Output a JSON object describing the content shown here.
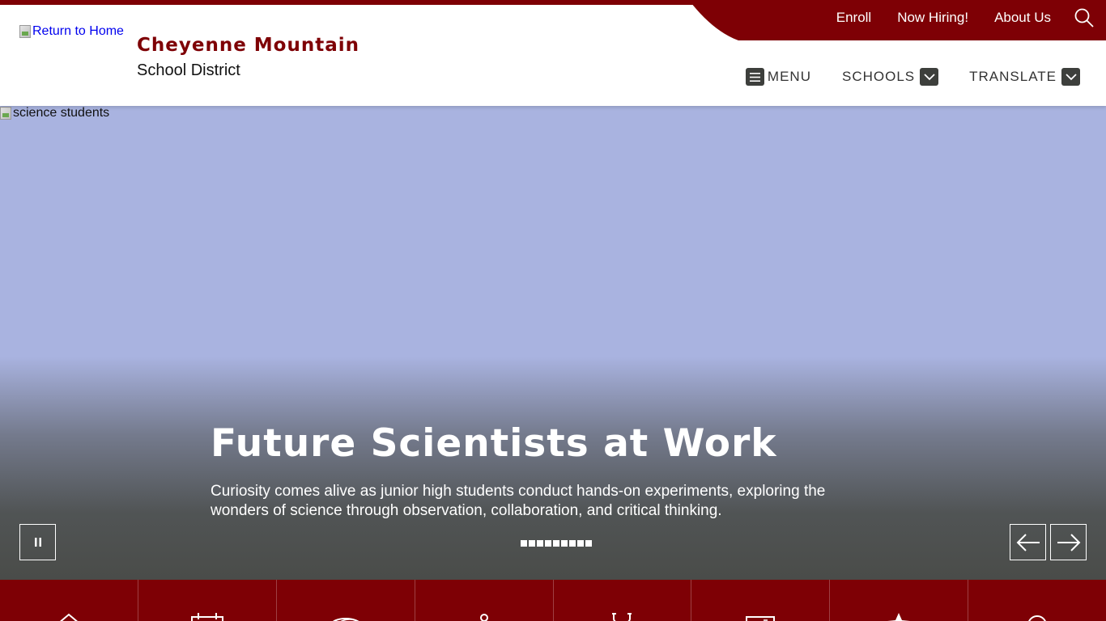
{
  "header": {
    "logo_alt": "Return to Home",
    "district_name": "Cheyenne Mountain",
    "district_subtitle": "School District"
  },
  "utility_nav": {
    "links": [
      "Enroll",
      "Now Hiring!",
      "About Us"
    ],
    "search_icon": "search-icon"
  },
  "main_nav": {
    "menu_label": "MENU",
    "schools_label": "SCHOOLS",
    "translate_label": "TRANSLATE"
  },
  "hero": {
    "image_alt": "science students",
    "title": "Future Scientists at Work",
    "description": "Curiosity comes alive as junior high students conduct hands-on experiments, exploring the wonders of science through observation, collaboration, and critical thinking.",
    "slide_count": 9,
    "active_slide": 1
  },
  "quick_links": {
    "icons": [
      "home-icon",
      "calendar-icon",
      "food-icon",
      "person-icon",
      "stethoscope-icon",
      "computer-icon",
      "star-icon",
      "search-icon"
    ]
  },
  "colors": {
    "brand": "#7e0005",
    "hero_bg": "#a9b3e0",
    "overlay": "#4a4c49",
    "nav_box": "#3d3f3c"
  }
}
